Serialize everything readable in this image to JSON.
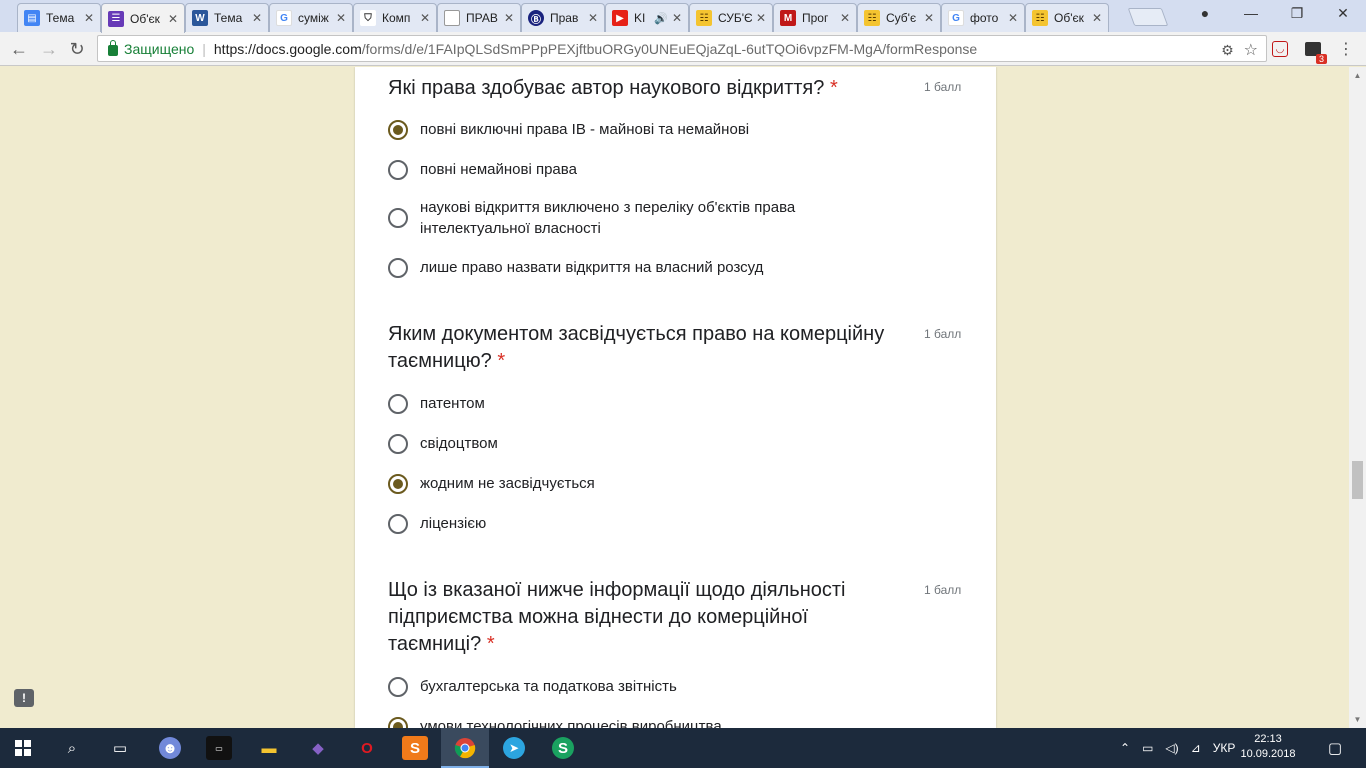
{
  "browser": {
    "tabs": [
      {
        "label": "Тема",
        "icon": "google-sites-icon",
        "color": "#4285f4"
      },
      {
        "label": "Об'єк",
        "icon": "google-forms-icon",
        "color": "#673ab7",
        "active": true
      },
      {
        "label": "Тема",
        "icon": "word-icon",
        "color": "#2b579a"
      },
      {
        "label": "суміж",
        "icon": "google-icon",
        "color": "#4285f4"
      },
      {
        "label": "Комп",
        "icon": "shield-icon",
        "color": "#555555"
      },
      {
        "label": "ПРАВ",
        "icon": "document-icon",
        "color": "#777777"
      },
      {
        "label": "Прав",
        "icon": "site-icon",
        "color": "#1a237e"
      },
      {
        "label": "KI",
        "icon": "youtube-icon",
        "color": "#e62117",
        "audio": true
      },
      {
        "label": "СУБ'Є",
        "icon": "library-icon",
        "color": "#b8860b"
      },
      {
        "label": "Прог",
        "icon": "mcafee-icon",
        "color": "#c01818"
      },
      {
        "label": "Суб'є",
        "icon": "library-icon",
        "color": "#b8860b"
      },
      {
        "label": "фото",
        "icon": "google-icon",
        "color": "#4285f4"
      },
      {
        "label": "Об'єк",
        "icon": "library-icon",
        "color": "#b8860b"
      }
    ],
    "secure_label": "Защищено",
    "url_host": "https://docs.google.com",
    "url_path": "/forms/d/e/1FAIpQLSdSmPPpPEXjftbuORGy0UNEuEQjaZqL-6utTQOi6vpzFM-MgA/formResponse",
    "extension_badge": "3"
  },
  "form": {
    "questions": [
      {
        "title": "Які права здобуває автор наукового відкриття?",
        "required_mark": "*",
        "points": "1 балл",
        "options": [
          {
            "label": "повні виключні права ІВ - майнові та немайнові",
            "selected": true
          },
          {
            "label": "повні немайнові права",
            "selected": false
          },
          {
            "label": "наукові відкриття виключено з переліку об'єктів права інтелектуальної власності",
            "selected": false
          },
          {
            "label": "лише право назвати відкриття на власний розсуд",
            "selected": false
          }
        ]
      },
      {
        "title": "Яким документом засвідчується право на комерційну таємницю?",
        "required_mark": "*",
        "points": "1 балл",
        "options": [
          {
            "label": "патентом",
            "selected": false
          },
          {
            "label": "свідоцтвом",
            "selected": false
          },
          {
            "label": "жодним не засвідчується",
            "selected": true
          },
          {
            "label": "ліцензією",
            "selected": false
          }
        ]
      },
      {
        "title": "Що із вказаної нижче інформації щодо діяльності підприємства можна віднести до комерційної таємниці?",
        "required_mark": "*",
        "points": "1 балл",
        "options": [
          {
            "label": "бухгалтерська та податкова звітність",
            "selected": false
          },
          {
            "label": "умови технологічних процесів виробництва",
            "selected": true
          }
        ]
      }
    ]
  },
  "taskbar": {
    "language": "УКР",
    "time": "22:13",
    "date": "10.09.2018"
  }
}
